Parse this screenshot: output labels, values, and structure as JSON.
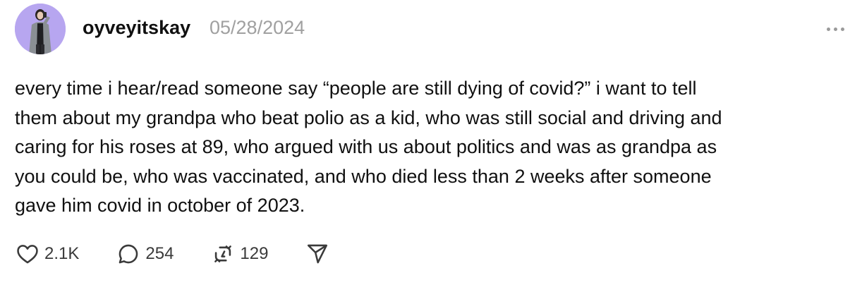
{
  "post": {
    "username": "oyveyitskay",
    "timestamp": "05/28/2024",
    "body": "every time i hear/read someone say “people are still dying of covid?” i want to tell\nthem about my grandpa who beat polio as a kid, who was still social and driving and\ncaring for his roses at 89, who argued with us about politics and was as grandpa as\nyou could be, who was vaccinated, and who died less than 2 weeks after someone\ngave him covid in october of 2023.",
    "avatar_bg": "#b7a6f0"
  },
  "actions": {
    "likes": "2.1K",
    "replies": "254",
    "reposts": "129",
    "like_icon": "heart-icon",
    "reply_icon": "speech-bubble-icon",
    "repost_icon": "repost-icon",
    "share_icon": "send-icon"
  }
}
